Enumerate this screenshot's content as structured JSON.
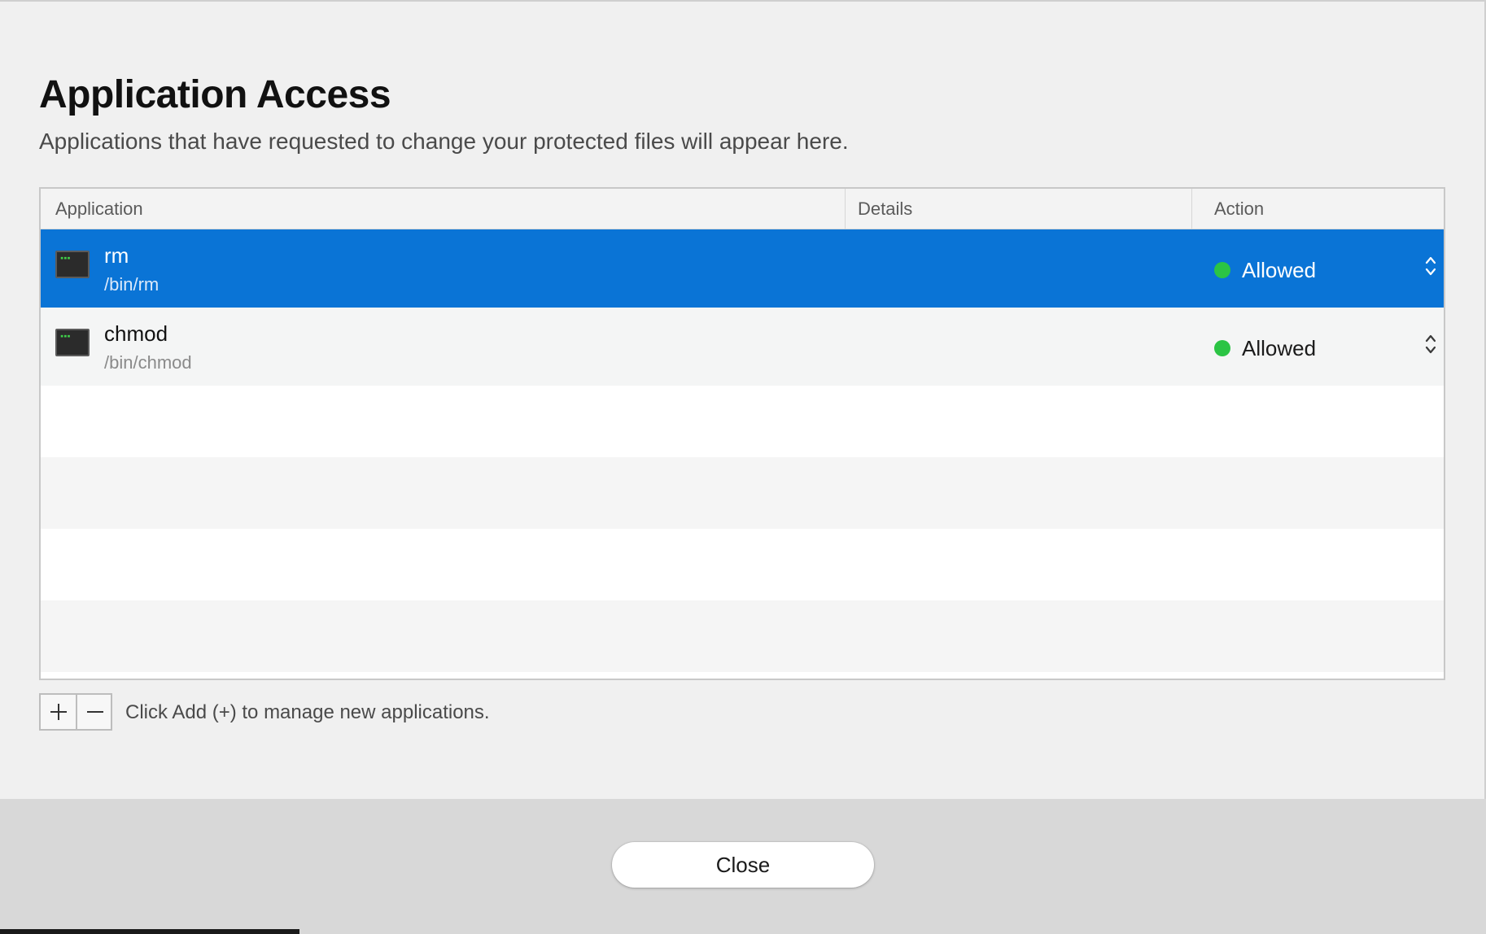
{
  "header": {
    "title": "Application Access",
    "subtitle": "Applications that have requested to change your protected files will appear here."
  },
  "table": {
    "columns": [
      "Application",
      "Details",
      "Action"
    ],
    "rows": [
      {
        "name": "rm",
        "path": "/bin/rm",
        "details": "",
        "action": "Allowed",
        "status_color": "#2bc444",
        "selected": true
      },
      {
        "name": "chmod",
        "path": "/bin/chmod",
        "details": "",
        "action": "Allowed",
        "status_color": "#2bc444",
        "selected": false
      }
    ],
    "icon": "terminal-icon"
  },
  "controls": {
    "add_icon": "plus-icon",
    "remove_icon": "minus-icon",
    "hint": "Click Add (+) to manage new applications."
  },
  "footer": {
    "close_label": "Close"
  },
  "colors": {
    "selection": "#0a74d6",
    "status_allowed": "#2bc444"
  }
}
